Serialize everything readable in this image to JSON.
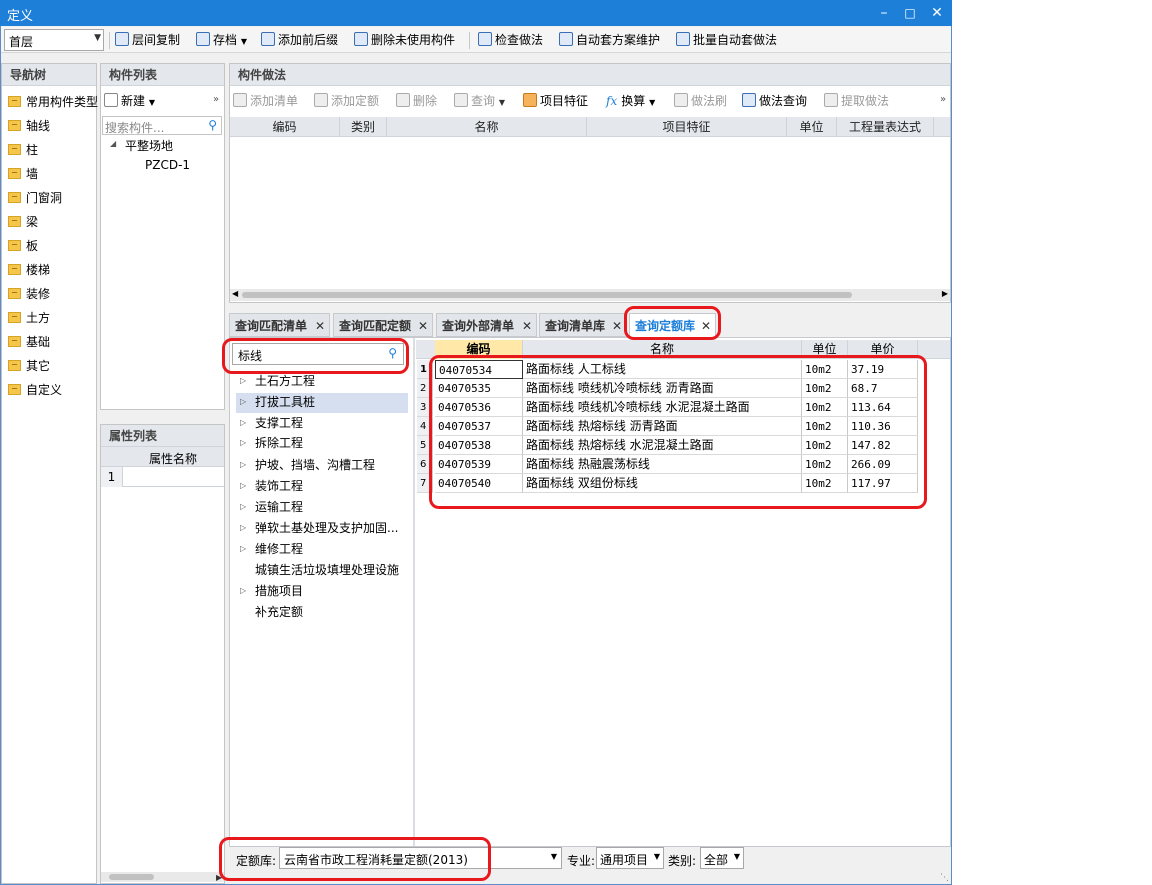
{
  "window": {
    "title": "定义"
  },
  "toolbar": {
    "floor_value": "首层",
    "items": [
      "层间复制",
      "存档",
      "添加前后缀",
      "删除未使用构件",
      "检查做法",
      "自动套方案维护",
      "批量自动套做法"
    ]
  },
  "nav": {
    "title": "导航树",
    "items": [
      "常用构件类型",
      "轴线",
      "柱",
      "墙",
      "门窗洞",
      "梁",
      "板",
      "楼梯",
      "装修",
      "土方",
      "基础",
      "其它",
      "自定义"
    ]
  },
  "component_list": {
    "title": "构件列表",
    "new_label": "新建",
    "search_placeholder": "搜索构件...",
    "tree_root": "平整场地",
    "tree_child": "PZCD-1"
  },
  "properties": {
    "title": "属性列表",
    "col_name": "属性名称",
    "row1": "1"
  },
  "method": {
    "title": "构件做法",
    "toolbar": [
      "添加清单",
      "添加定额",
      "删除",
      "查询",
      "项目特征",
      "换算",
      "做法刷",
      "做法查询",
      "提取做法"
    ],
    "columns": [
      "编码",
      "类别",
      "名称",
      "项目特征",
      "单位",
      "工程量表达式"
    ]
  },
  "tabs": [
    "查询匹配清单",
    "查询匹配定额",
    "查询外部清单",
    "查询清单库",
    "查询定额库"
  ],
  "search": {
    "value": "标线"
  },
  "tree": [
    "土石方工程",
    "打拔工具桩",
    "支撑工程",
    "拆除工程",
    "护坡、挡墙、沟槽工程",
    "装饰工程",
    "运输工程",
    "弹软土基处理及支护加固...",
    "维修工程",
    "城镇生活垃圾填埋处理设施",
    "措施项目",
    "补充定额"
  ],
  "results": {
    "columns": [
      "编码",
      "名称",
      "单位",
      "单价"
    ],
    "rows": [
      {
        "num": "1",
        "code": "04070534",
        "name": "路面标线 人工标线",
        "unit": "10m2",
        "price": "37.19"
      },
      {
        "num": "2",
        "code": "04070535",
        "name": "路面标线 喷线机冷喷标线 沥青路面",
        "unit": "10m2",
        "price": "68.7"
      },
      {
        "num": "3",
        "code": "04070536",
        "name": "路面标线 喷线机冷喷标线 水泥混凝土路面",
        "unit": "10m2",
        "price": "113.64"
      },
      {
        "num": "4",
        "code": "04070537",
        "name": "路面标线 热熔标线 沥青路面",
        "unit": "10m2",
        "price": "110.36"
      },
      {
        "num": "5",
        "code": "04070538",
        "name": "路面标线 热熔标线 水泥混凝土路面",
        "unit": "10m2",
        "price": "147.82"
      },
      {
        "num": "6",
        "code": "04070539",
        "name": "路面标线 热融震荡标线",
        "unit": "10m2",
        "price": "266.09"
      },
      {
        "num": "7",
        "code": "04070540",
        "name": "路面标线 双组份标线",
        "unit": "10m2",
        "price": "117.97"
      }
    ]
  },
  "footer": {
    "lib_label": "定额库:",
    "lib_value": "云南省市政工程消耗量定额(2013)",
    "major_label": "专业:",
    "major_value": "通用项目",
    "cat_label": "类别:",
    "cat_value": "全部"
  }
}
